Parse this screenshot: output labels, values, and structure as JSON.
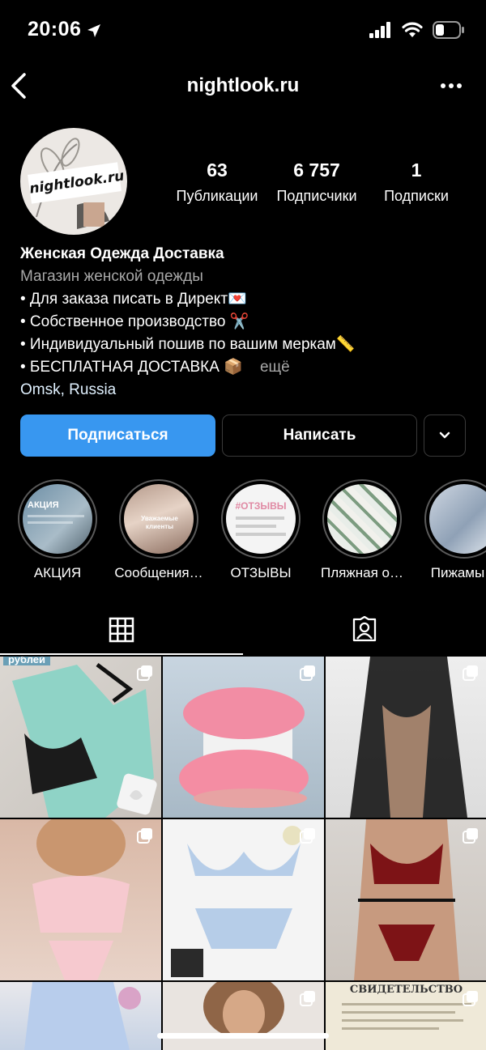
{
  "status": {
    "time": "20:06"
  },
  "header": {
    "username": "nightlook.ru"
  },
  "profile": {
    "avatar_text": "nightlook.ru",
    "stats": [
      {
        "value": "63",
        "label": "Публикации"
      },
      {
        "value": "6 757",
        "label": "Подписчики"
      },
      {
        "value": "1",
        "label": "Подписки"
      }
    ]
  },
  "bio": {
    "name": "Женская Одежда Доставка",
    "category": "Магазин женской одежды",
    "lines": [
      "• Для заказа писать в Директ💌",
      "• Собственное производство ✂️",
      "• Индивидуальный пошив по вашим меркам📏",
      "• БЕСПЛАТНАЯ ДОСТАВКА 📦"
    ],
    "more": "ещё",
    "location": "Omsk, Russia"
  },
  "actions": {
    "follow": "Подписаться",
    "message": "Написать"
  },
  "highlights": [
    {
      "label": "АКЦИЯ",
      "overlay": "АКЦИЯ"
    },
    {
      "label": "Сообщения…",
      "overlay": "Уважаемые клиенты"
    },
    {
      "label": "ОТЗЫВЫ",
      "overlay": "#ОТЗЫВЫ"
    },
    {
      "label": "Пляжная о…",
      "overlay": ""
    },
    {
      "label": "Пижамы",
      "overlay": ""
    }
  ],
  "grid": {
    "posts": [
      {
        "label": "mint satin pajama set with black lace bra",
        "overlay": "рублей"
      },
      {
        "label": "pink fluffy slippers",
        "overlay": ""
      },
      {
        "label": "black sheer robe",
        "overlay": ""
      },
      {
        "label": "pink lace lingerie set",
        "overlay": ""
      },
      {
        "label": "light blue embroidered lingerie set",
        "overlay": ""
      },
      {
        "label": "red lace harness lingerie",
        "overlay": ""
      },
      {
        "label": "light blue nightgown",
        "overlay": ""
      },
      {
        "label": "model in white lingerie",
        "overlay": ""
      },
      {
        "label": "registration certificate",
        "overlay": "СВИДЕТЕЛЬСТВО"
      }
    ]
  }
}
